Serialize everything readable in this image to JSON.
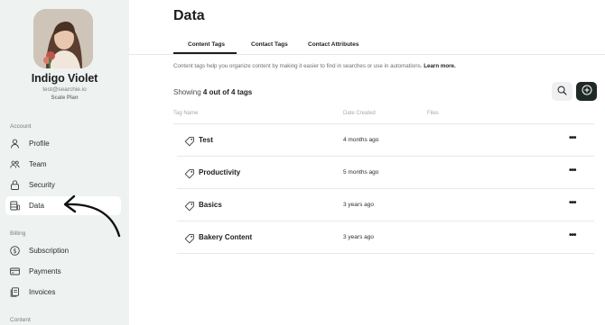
{
  "user": {
    "name": "Indigo Violet",
    "email": "test@searchie.io",
    "plan": "Scale Plan"
  },
  "sidebar": {
    "sections": [
      {
        "label": "Account"
      },
      {
        "label": "Billing"
      },
      {
        "label": "Content"
      }
    ],
    "items": [
      {
        "label": "Profile",
        "icon": "user-icon"
      },
      {
        "label": "Team",
        "icon": "team-icon"
      },
      {
        "label": "Security",
        "icon": "lock-icon"
      },
      {
        "label": "Data",
        "icon": "database-icon",
        "active": true
      },
      {
        "label": "Subscription",
        "icon": "dollar-icon"
      },
      {
        "label": "Payments",
        "icon": "credit-card-icon"
      },
      {
        "label": "Invoices",
        "icon": "invoice-icon"
      }
    ]
  },
  "main": {
    "title": "Data",
    "tabs": [
      {
        "label": "Content Tags",
        "active": true
      },
      {
        "label": "Contact Tags"
      },
      {
        "label": "Contact Attributes"
      }
    ],
    "description": "Content tags help you organize content by making it easier to find in searches or use in automations.",
    "learn_more": "Learn more.",
    "showing_prefix": "Showing",
    "showing_count": "4 out of 4 tags",
    "columns": [
      "Tag Name",
      "Date Created",
      "Files"
    ],
    "rows": [
      {
        "name": "Test",
        "date": "4 months ago",
        "more": "•••"
      },
      {
        "name": "Productivity",
        "date": "5 months ago",
        "more": "•••"
      },
      {
        "name": "Basics",
        "date": "3 years ago",
        "more": "•••"
      },
      {
        "name": "Bakery Content",
        "date": "3 years ago",
        "more": "•••"
      }
    ]
  },
  "colors": {
    "sidebar_bg": "#eef2f0",
    "accent_dark": "#1f2a26",
    "border": "#e6e8ea"
  }
}
